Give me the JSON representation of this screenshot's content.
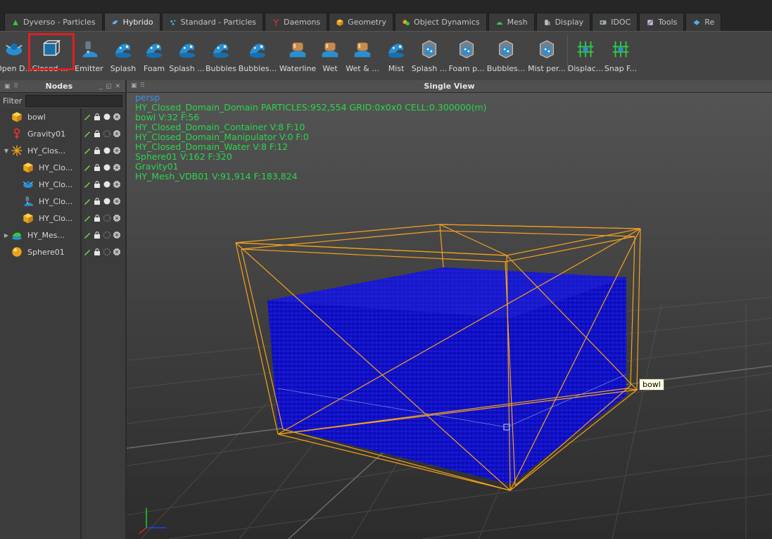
{
  "tabs": [
    {
      "label": "Dyverso - Particles",
      "icon": "dyverso-particles-icon",
      "active": false
    },
    {
      "label": "Hybrido",
      "icon": "hybrido-icon",
      "active": true
    },
    {
      "label": "Standard - Particles",
      "icon": "standard-particles-icon",
      "active": false
    },
    {
      "label": "Daemons",
      "icon": "daemons-icon",
      "active": false
    },
    {
      "label": "Geometry",
      "icon": "geometry-icon",
      "active": false
    },
    {
      "label": "Object Dynamics",
      "icon": "object-dynamics-icon",
      "active": false
    },
    {
      "label": "Mesh",
      "icon": "mesh-icon",
      "active": false
    },
    {
      "label": "Display",
      "icon": "display-icon",
      "active": false
    },
    {
      "label": "IDOC",
      "icon": "idoc-icon",
      "active": false
    },
    {
      "label": "Tools",
      "icon": "tools-icon",
      "active": false
    },
    {
      "label": "Re",
      "icon": "render-icon",
      "active": false
    }
  ],
  "shelf": [
    {
      "label": "Open D...",
      "icon": "open-domain-icon"
    },
    {
      "label": "Closed ...",
      "icon": "closed-domain-icon",
      "highlighted": true
    },
    {
      "label": "Emitter",
      "icon": "emitter-icon"
    },
    {
      "label": "Splash",
      "icon": "splash-icon"
    },
    {
      "label": "Foam",
      "icon": "foam-icon"
    },
    {
      "label": "Splash ...",
      "icon": "splash-secondary-icon"
    },
    {
      "label": "Bubbles",
      "icon": "bubbles-icon"
    },
    {
      "label": "Bubbles...",
      "icon": "bubbles-secondary-icon"
    },
    {
      "label": "Waterline",
      "icon": "waterline-icon"
    },
    {
      "label": "Wet",
      "icon": "wet-icon"
    },
    {
      "label": "Wet & ...",
      "icon": "wet-and-icon"
    },
    {
      "label": "Mist",
      "icon": "mist-icon"
    },
    {
      "label": "Splash ...",
      "icon": "splash-per-icon"
    },
    {
      "label": "Foam p...",
      "icon": "foam-per-icon"
    },
    {
      "label": "Bubbles...",
      "icon": "bubbles-per-icon"
    },
    {
      "label": "Mist per...",
      "icon": "mist-per-icon"
    },
    {
      "label": "Displac...",
      "icon": "displacement-icon"
    },
    {
      "label": "Snap F...",
      "icon": "snap-icon"
    }
  ],
  "nodes_panel": {
    "title": "Nodes",
    "filter_label": "Filter",
    "filter_value": "",
    "items": [
      {
        "name": "bowl",
        "icon": "cube-icon",
        "expander": "",
        "indent": 0
      },
      {
        "name": "Gravity01",
        "icon": "gravity-icon",
        "expander": "",
        "indent": 0
      },
      {
        "name": "HY_Clos...",
        "icon": "domain-star-icon",
        "expander": "▼",
        "indent": 0
      },
      {
        "name": "HY_Clo...",
        "icon": "cube-icon",
        "expander": "",
        "indent": 1
      },
      {
        "name": "HY_Clo...",
        "icon": "manipulator-icon",
        "expander": "",
        "indent": 1
      },
      {
        "name": "HY_Clo...",
        "icon": "water-emitter-icon",
        "expander": "",
        "indent": 1
      },
      {
        "name": "HY_Clo...",
        "icon": "cube-icon",
        "expander": "",
        "indent": 1
      },
      {
        "name": "HY_Mes...",
        "icon": "mesh-node-icon",
        "expander": "▶",
        "indent": 0
      },
      {
        "name": "Sphere01",
        "icon": "sphere-icon",
        "expander": "",
        "indent": 0
      }
    ]
  },
  "viewport": {
    "title": "Single View",
    "camera": "persp",
    "hud_lines": [
      "HY_Closed_Domain_Domain PARTICLES:952,554 GRID:0x0x0 CELL:0.300000(m)",
      "bowl V:32 F:56",
      "HY_Closed_Domain_Container V:8 F:10",
      "HY_Closed_Domain_Manipulator V:0 F:0",
      "HY_Closed_Domain_Water V:8 F:12",
      "Sphere01 V:162 F:320",
      "Gravity01",
      "HY_Mesh_VDB01 V:91,914 F:183,824"
    ],
    "tooltip": "bowl"
  },
  "colors": {
    "hud_text": "#2ad64a",
    "camera_label": "#3e8fe6",
    "particles": "#0a0ac8",
    "wireframe": "#f5a21a",
    "highlight": "#e02020"
  }
}
